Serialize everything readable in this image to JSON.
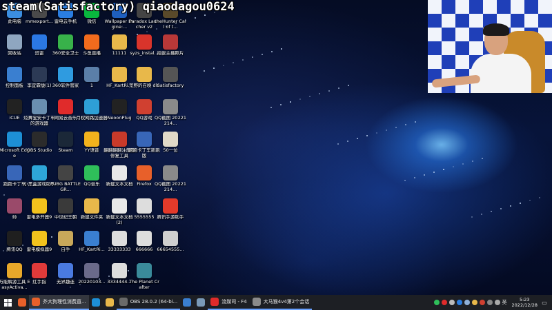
{
  "stream_overlay": {
    "title": "steam(Satisfactory) qiaodagou0624"
  },
  "desktop_icons": [
    {
      "label": "此电脑",
      "icon": "computer-icon",
      "color": "#3b8ee0"
    },
    {
      "label": "mmexport...",
      "icon": "image-file-icon",
      "color": "#4a4a4a"
    },
    {
      "label": "雷电云手机",
      "icon": "cloud-phone-icon",
      "color": "#2a7de1"
    },
    {
      "label": "微信",
      "icon": "wechat-icon",
      "color": "#09b83e"
    },
    {
      "label": "Wallpaper Engine:...",
      "icon": "wallpaper-engine-icon",
      "color": "#1e5fbf"
    },
    {
      "label": "Paradox Launcher v2",
      "icon": "paradox-icon",
      "color": "#444444"
    },
    {
      "label": "theHunter Call of t...",
      "icon": "hunter-game-icon",
      "color": "#5a4a2a"
    },
    {
      "label": "回收站",
      "icon": "recycle-bin-icon",
      "color": "#8fa6c0"
    },
    {
      "label": "迅雷",
      "icon": "thunder-download-icon",
      "color": "#2b78e4"
    },
    {
      "label": "360安全卫士",
      "icon": "360-security-icon",
      "color": "#38b24a"
    },
    {
      "label": "斗鱼直播",
      "icon": "douyu-icon",
      "color": "#f26b1d"
    },
    {
      "label": "11111",
      "icon": "folder-icon",
      "color": "#e8b84a"
    },
    {
      "label": "syzs_instal...",
      "icon": "installer-icon",
      "color": "#d9342b"
    },
    {
      "label": "指嵌主播照片",
      "icon": "photo-app-icon",
      "color": "#b83838"
    },
    {
      "label": "控制面板",
      "icon": "control-panel-icon",
      "color": "#3a7fd0"
    },
    {
      "label": "李宜霖版(1)",
      "icon": "document-icon",
      "color": "#2c3a55"
    },
    {
      "label": "360软件管家",
      "icon": "360-software-icon",
      "color": "#2f9be0"
    },
    {
      "label": "1",
      "icon": "image-file-icon",
      "color": "#5b7fa8"
    },
    {
      "label": "HF_KartRi...",
      "icon": "folder-icon",
      "color": "#e8b84a"
    },
    {
      "label": "荒野的召唤 dlc",
      "icon": "folder-icon",
      "color": "#e8b84a"
    },
    {
      "label": "Satisfactory",
      "icon": "satisfactory-icon",
      "color": "#555555"
    },
    {
      "label": "iCUE",
      "icon": "icue-icon",
      "color": "#222222"
    },
    {
      "label": "炫舞宝安卡丁车的游戏器",
      "icon": "game-icon",
      "color": "#6a8fb0"
    },
    {
      "label": "网易云音乐",
      "icon": "netease-music-icon",
      "color": "#e02b2b"
    },
    {
      "label": "月权网路加速器",
      "icon": "accelerator-icon",
      "color": "#2e9fd6"
    },
    {
      "label": "NeoonPlug",
      "icon": "neon-plug-icon",
      "color": "#222222"
    },
    {
      "label": "QQ游戏",
      "icon": "qq-game-icon",
      "color": "#d04030"
    },
    {
      "label": "QQ截图 20221214...",
      "icon": "image-file-icon",
      "color": "#8a8a8a"
    },
    {
      "label": "Microsoft Edge",
      "icon": "edge-icon",
      "color": "#1d8fd6"
    },
    {
      "label": "OBS Studio",
      "icon": "obs-icon",
      "color": "#2b2b2b"
    },
    {
      "label": "Steam",
      "icon": "steam-icon",
      "color": "#1b2838"
    },
    {
      "label": "YY语音",
      "icon": "yy-icon",
      "color": "#f2b21d"
    },
    {
      "label": "翻翻翻翻注册表修复工具",
      "icon": "mario-tool-icon",
      "color": "#c83a2a"
    },
    {
      "label": "跑跑卡丁车新跑版",
      "icon": "kart-icon",
      "color": "#3866b8"
    },
    {
      "label": "50一位",
      "icon": "document-icon",
      "color": "#e0d9c8"
    },
    {
      "label": "跑跑卡丁车",
      "icon": "kart-icon",
      "color": "#3866b8"
    },
    {
      "label": "小黑盒游戏助手",
      "icon": "heybox-icon",
      "color": "#2ea6d8"
    },
    {
      "label": "PUBG BATTLEGR...",
      "icon": "pubg-icon",
      "color": "#444444"
    },
    {
      "label": "QQ音乐",
      "icon": "qq-music-icon",
      "color": "#2fbf5a"
    },
    {
      "label": "新建文本文档",
      "icon": "text-file-icon",
      "color": "#e8e8e8"
    },
    {
      "label": "Firefox",
      "icon": "firefox-icon",
      "color": "#e8602a"
    },
    {
      "label": "QQ截图 20221214...",
      "icon": "image-file-icon",
      "color": "#8a8a8a"
    },
    {
      "label": "帅",
      "icon": "image-file-icon",
      "color": "#9a4a6a"
    },
    {
      "label": "雷电多开器9",
      "icon": "ldplayer-multi-icon",
      "color": "#f2c21d"
    },
    {
      "label": "中世纪王朝",
      "icon": "medieval-game-icon",
      "color": "#3a3a3a"
    },
    {
      "label": "新建文件夹",
      "icon": "folder-icon",
      "color": "#e8b84a"
    },
    {
      "label": "新建文本文档 (2)",
      "icon": "text-file-icon",
      "color": "#e8e8e8"
    },
    {
      "label": "5555555",
      "icon": "spreadsheet-icon",
      "color": "#dddddd"
    },
    {
      "label": "腾讯手游助手",
      "icon": "tencent-mobile-icon",
      "color": "#e23a2a"
    },
    {
      "label": "腾讯QQ",
      "icon": "qq-icon",
      "color": "#1f1f1f"
    },
    {
      "label": "雷电模拟器9",
      "icon": "ldplayer-icon",
      "color": "#f2c21d"
    },
    {
      "label": "白手",
      "icon": "tool-icon",
      "color": "#c8a85a"
    },
    {
      "label": "HF_KartRi...",
      "icon": "folder-icon",
      "color": "#3a7fd0"
    },
    {
      "label": "33333333",
      "icon": "spreadsheet-icon",
      "color": "#dddddd"
    },
    {
      "label": "666666",
      "icon": "spreadsheet-icon",
      "color": "#dddddd"
    },
    {
      "label": "66654555...",
      "icon": "document-icon",
      "color": "#cfcfcf"
    },
    {
      "label": "万能解游工具 EasyActiva...",
      "icon": "tool-icon",
      "color": "#e8a82a"
    },
    {
      "label": "红手指",
      "icon": "red-finger-icon",
      "color": "#e03a3a"
    },
    {
      "label": "无界趣连",
      "icon": "wujie-icon",
      "color": "#4a7ae0"
    },
    {
      "label": "20220103...",
      "icon": "image-file-icon",
      "color": "#6a6a8a"
    },
    {
      "label": "3334444...",
      "icon": "spreadsheet-icon",
      "color": "#dddddd"
    },
    {
      "label": "The Planet Crafter",
      "icon": "planet-crafter-icon",
      "color": "#3a8a9a"
    }
  ],
  "taskbar": {
    "apps": [
      {
        "label": "",
        "icon": "firefox-icon",
        "color": "#e8602a"
      },
      {
        "label": "芥大狗理性消费直...",
        "icon": "firefox-icon",
        "color": "#e8602a"
      },
      {
        "label": "",
        "icon": "edge-icon",
        "color": "#1d8fd6"
      },
      {
        "label": "",
        "icon": "file-explorer-icon",
        "color": "#e8b84a"
      },
      {
        "label": "OBS 28.0.2 (64-bi...",
        "icon": "obs-icon",
        "color": "#6a6a6a"
      },
      {
        "label": "",
        "icon": "pin-app-icon",
        "color": "#3a7fd0"
      },
      {
        "label": "",
        "icon": "notepad-icon",
        "color": "#7a9ab8"
      },
      {
        "label": "流媒司 - F4",
        "icon": "netease-music-icon",
        "color": "#e02b2b"
      },
      {
        "label": "大马猴4v4第2个会话",
        "icon": "game-icon",
        "color": "#8a8a8a"
      }
    ],
    "tray": {
      "ime": "英",
      "time": "5:23",
      "date": "2022/12/28"
    }
  }
}
